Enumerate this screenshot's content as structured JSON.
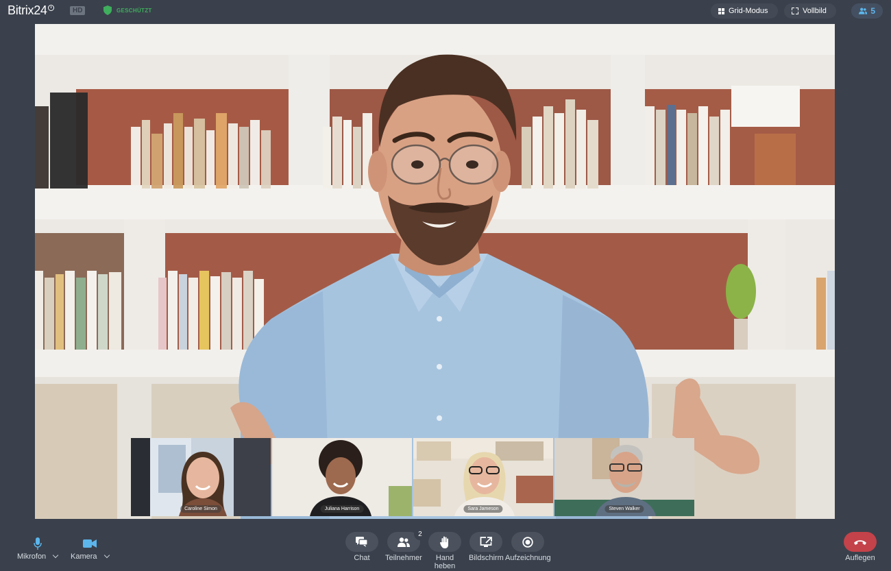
{
  "app": {
    "logo": "Bitrix24",
    "hd_badge": "HD",
    "secure_label": "GESCHÜTZT"
  },
  "topbar": {
    "grid_mode_label": "Grid-Modus",
    "fullscreen_label": "Vollbild",
    "participants_count": "5"
  },
  "thumbnails": [
    {
      "name": "Caroline Simon"
    },
    {
      "name": "Juliana Harrison"
    },
    {
      "name": "Sara Jameson"
    },
    {
      "name": "Steven Walker"
    }
  ],
  "controls": {
    "microphone_label": "Mikrofon",
    "camera_label": "Kamera",
    "chat_label": "Chat",
    "participants_label": "Teilnehmer",
    "participants_badge": "2",
    "raise_hand_label_1": "Hand",
    "raise_hand_label_2": "heben",
    "screen_label": "Bildschirm",
    "record_label": "Aufzeichnung",
    "hangup_label": "Auflegen"
  },
  "colors": {
    "background": "#3a414c",
    "accent_blue": "#5cb6ec",
    "secure_green": "#3fae5d",
    "hangup_red": "#c4424a"
  }
}
